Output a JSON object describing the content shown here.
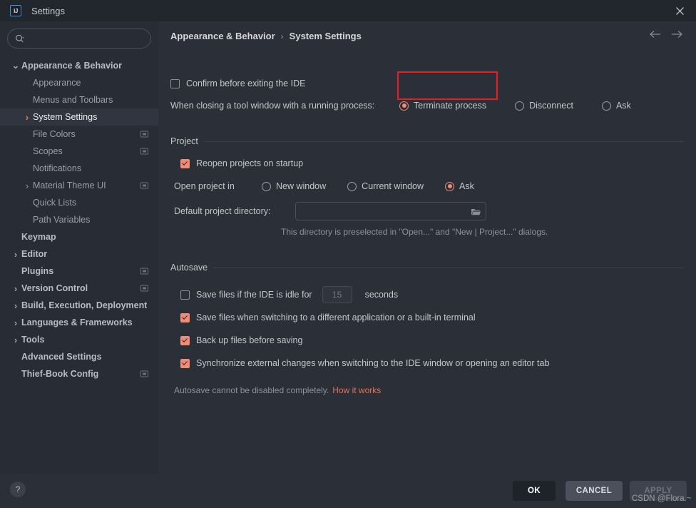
{
  "window": {
    "title": "Settings",
    "app_icon": "IJ",
    "close_label": "×"
  },
  "search": {
    "placeholder": "",
    "value": "",
    "icon": "search-icon"
  },
  "sidebar": {
    "items": [
      {
        "label": "Appearance & Behavior",
        "indent": 0,
        "chevron": "down",
        "bold": true,
        "selected": false,
        "scope_icon": false
      },
      {
        "label": "Appearance",
        "indent": 1,
        "chevron": "none",
        "bold": false,
        "selected": false,
        "scope_icon": false
      },
      {
        "label": "Menus and Toolbars",
        "indent": 1,
        "chevron": "none",
        "bold": false,
        "selected": false,
        "scope_icon": false
      },
      {
        "label": "System Settings",
        "indent": 1,
        "chevron": "right-orange",
        "bold": false,
        "selected": true,
        "scope_icon": false
      },
      {
        "label": "File Colors",
        "indent": 1,
        "chevron": "none",
        "bold": false,
        "selected": false,
        "scope_icon": true
      },
      {
        "label": "Scopes",
        "indent": 1,
        "chevron": "none",
        "bold": false,
        "selected": false,
        "scope_icon": true
      },
      {
        "label": "Notifications",
        "indent": 1,
        "chevron": "none",
        "bold": false,
        "selected": false,
        "scope_icon": false
      },
      {
        "label": "Material Theme UI",
        "indent": 1,
        "chevron": "right",
        "bold": false,
        "selected": false,
        "scope_icon": true
      },
      {
        "label": "Quick Lists",
        "indent": 1,
        "chevron": "none",
        "bold": false,
        "selected": false,
        "scope_icon": false
      },
      {
        "label": "Path Variables",
        "indent": 1,
        "chevron": "none",
        "bold": false,
        "selected": false,
        "scope_icon": false
      },
      {
        "label": "Keymap",
        "indent": 0,
        "chevron": "none",
        "bold": true,
        "selected": false,
        "scope_icon": false
      },
      {
        "label": "Editor",
        "indent": 0,
        "chevron": "right",
        "bold": true,
        "selected": false,
        "scope_icon": false
      },
      {
        "label": "Plugins",
        "indent": 0,
        "chevron": "none",
        "bold": true,
        "selected": false,
        "scope_icon": true
      },
      {
        "label": "Version Control",
        "indent": 0,
        "chevron": "right",
        "bold": true,
        "selected": false,
        "scope_icon": true
      },
      {
        "label": "Build, Execution, Deployment",
        "indent": 0,
        "chevron": "right",
        "bold": true,
        "selected": false,
        "scope_icon": false
      },
      {
        "label": "Languages & Frameworks",
        "indent": 0,
        "chevron": "right",
        "bold": true,
        "selected": false,
        "scope_icon": false
      },
      {
        "label": "Tools",
        "indent": 0,
        "chevron": "right",
        "bold": true,
        "selected": false,
        "scope_icon": false
      },
      {
        "label": "Advanced Settings",
        "indent": 0,
        "chevron": "none",
        "bold": true,
        "selected": false,
        "scope_icon": false
      },
      {
        "label": "Thief-Book Config",
        "indent": 0,
        "chevron": "none",
        "bold": true,
        "selected": false,
        "scope_icon": true
      }
    ]
  },
  "breadcrumb": {
    "parent": "Appearance & Behavior",
    "separator": "›",
    "current": "System Settings"
  },
  "main": {
    "confirm_exit": {
      "label": "Confirm before exiting the IDE",
      "checked": false
    },
    "closing_tool_window": {
      "label": "When closing a tool window with a running process:",
      "options": [
        {
          "label": "Terminate process",
          "selected": true
        },
        {
          "label": "Disconnect",
          "selected": false
        },
        {
          "label": "Ask",
          "selected": false
        }
      ]
    },
    "project": {
      "group_title": "Project",
      "reopen": {
        "label": "Reopen projects on startup",
        "checked": true
      },
      "open_project_in_label": "Open project in",
      "open_project_in_options": [
        {
          "label": "New window",
          "selected": false
        },
        {
          "label": "Current window",
          "selected": false
        },
        {
          "label": "Ask",
          "selected": true
        }
      ],
      "default_dir_label": "Default project directory:",
      "default_dir_value": "",
      "default_dir_placeholder": "",
      "browse_icon": "folder-icon",
      "hint": "This directory is preselected in \"Open...\" and \"New | Project...\" dialogs."
    },
    "autosave": {
      "group_title": "Autosave",
      "idle": {
        "label": "Save files if the IDE is idle for",
        "checked": false,
        "seconds_value": "15",
        "suffix": "seconds"
      },
      "items": [
        {
          "label": "Save files when switching to a different application or a built-in terminal",
          "checked": true
        },
        {
          "label": "Back up files before saving",
          "checked": true
        },
        {
          "label": "Synchronize external changes when switching to the IDE window or opening an editor tab",
          "checked": true
        }
      ],
      "note": "Autosave cannot be disabled completely.",
      "note_link": "How it works"
    }
  },
  "footer": {
    "help_icon": "?",
    "ok_label": "OK",
    "cancel_label": "CANCEL",
    "apply_label": "APPLY"
  },
  "watermark": "CSDN @Flora.~",
  "colors": {
    "accent": "#f08b76",
    "link": "#e8705a",
    "annotation": "#ec1c24",
    "window_bg": "#2b2f37",
    "sidebar_bg": "#282c34",
    "titlebar_bg": "#22262d",
    "selection_bg": "#30353f"
  }
}
